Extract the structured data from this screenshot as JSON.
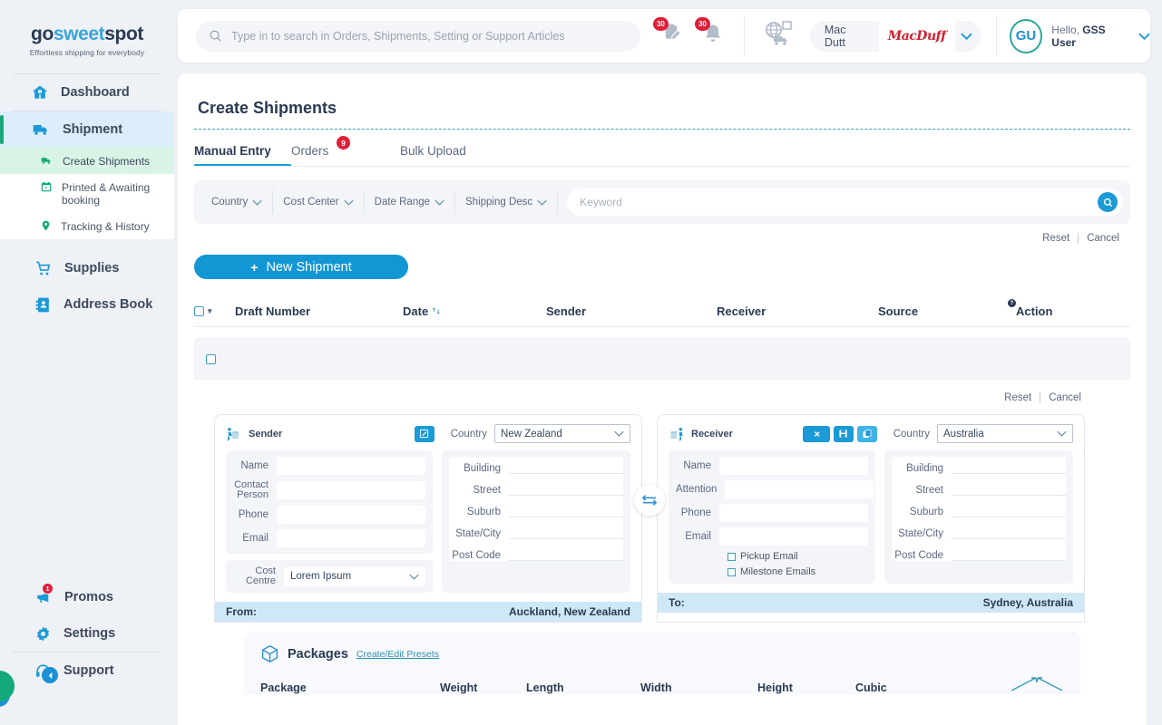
{
  "brand": {
    "logo_part1": "go",
    "logo_part2": "sweet",
    "logo_part3": "spot",
    "tagline": "Effortless shipping for everybody"
  },
  "sidebar": {
    "items": [
      {
        "label": "Dashboard",
        "icon": "home-icon"
      },
      {
        "label": "Shipment",
        "icon": "truck-icon"
      }
    ],
    "sub_items": [
      {
        "label": "Create Shipments",
        "icon": "truck-small-icon"
      },
      {
        "label": "Printed & Awaiting booking",
        "icon": "calendar-icon"
      },
      {
        "label": "Tracking & History",
        "icon": "pin-icon"
      }
    ],
    "items2": [
      {
        "label": "Supplies",
        "icon": "cart-icon"
      },
      {
        "label": "Address Book",
        "icon": "address-book-icon"
      }
    ],
    "bottom_items": [
      {
        "label": "Promos",
        "icon": "megaphone-icon",
        "badge": "1"
      },
      {
        "label": "Settings",
        "icon": "gear-icon"
      },
      {
        "label": "Support",
        "icon": "headset-icon"
      }
    ]
  },
  "topbar": {
    "search_placeholder": "Type in to search in Orders, Shipments, Setting or Support Articles",
    "search_value": "",
    "orders_badge": "30",
    "bell_badge": "30",
    "account_name": "Mac Dutt",
    "account_logo_text": "MacDuff",
    "avatar_initials": "GU",
    "greeting_prefix": "Hello, ",
    "greeting_user": "GSS User"
  },
  "page": {
    "title": "Create Shipments"
  },
  "tabs": [
    {
      "label": "Manual Entry",
      "badge": ""
    },
    {
      "label": "Orders",
      "badge": "9"
    },
    {
      "label": "Bulk Upload",
      "badge": ""
    }
  ],
  "filters": {
    "chips": [
      "Country",
      "Cost Center",
      "Date Range",
      "Shipping Desc"
    ],
    "keyword_placeholder": "Keyword",
    "keyword_value": ""
  },
  "actions": {
    "reset": "Reset",
    "cancel": "Cancel",
    "new_shipment": "New Shipment",
    "plus": "+"
  },
  "table": {
    "columns": [
      "Draft Number",
      "Date",
      "Sender",
      "Receiver",
      "Source",
      "Action"
    ]
  },
  "sender": {
    "title": "Sender",
    "country_label": "Country",
    "country_value": "New Zealand",
    "fields": [
      {
        "label": "Name",
        "value": ""
      },
      {
        "label": "Contact Person",
        "value": ""
      },
      {
        "label": "Phone",
        "value": ""
      },
      {
        "label": "Email",
        "value": ""
      }
    ],
    "address_fields": [
      "Building",
      "Street",
      "Suburb",
      "State/City",
      "Post Code"
    ],
    "cost_label": "Cost Centre",
    "cost_value": "Lorem Ipsum",
    "footer_label": "From:",
    "footer_value": "Auckland, New Zealand"
  },
  "receiver": {
    "title": "Receiver",
    "country_label": "Country",
    "country_value": "Australia",
    "fields": [
      {
        "label": "Name",
        "value": ""
      },
      {
        "label": "Attention",
        "value": ""
      },
      {
        "label": "Phone",
        "value": ""
      },
      {
        "label": "Email",
        "value": ""
      }
    ],
    "address_fields": [
      "Building",
      "Street",
      "Suburb",
      "State/City",
      "Post Code"
    ],
    "checkboxes": [
      "Pickup Email",
      "Milestone Emails"
    ],
    "footer_label": "To:",
    "footer_value": "Sydney, Australia"
  },
  "packages": {
    "title": "Packages",
    "link": "Create/Edit Presets",
    "columns": [
      "Package",
      "Weight",
      "Length",
      "Width",
      "Height",
      "Cubic"
    ]
  },
  "colors": {
    "accent_blue": "#1396d4",
    "accent_teal": "#2aa79a",
    "badge_red": "#e01e37",
    "dark_navy": "#2b3a53",
    "page_bg": "#eef1f6",
    "active_nav": "#dceefa",
    "active_sub": "#d9f4e6"
  }
}
